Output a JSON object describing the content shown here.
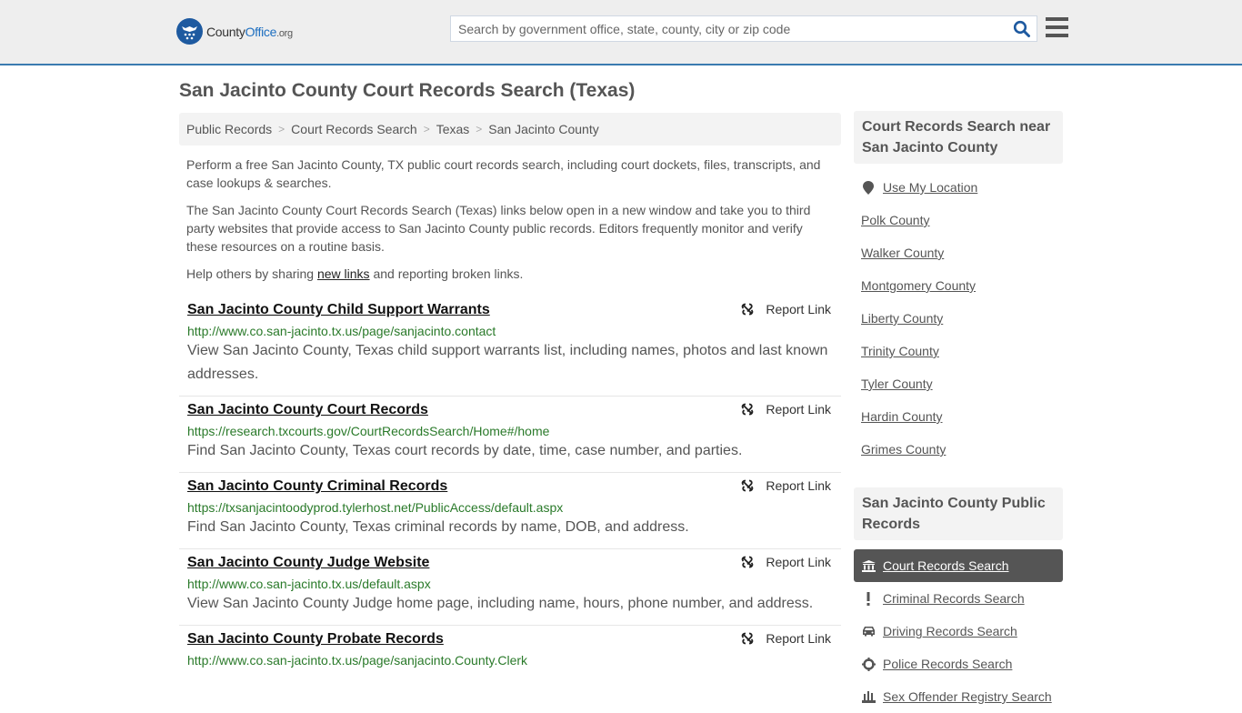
{
  "header": {
    "logo": {
      "prefix": "County",
      "brand": "Office",
      "suffix": ".org"
    },
    "search_placeholder": "Search by government office, state, county, city or zip code",
    "colors": {
      "accent": "#3a7bb0",
      "logo_blue": "#1e5aa0"
    }
  },
  "page": {
    "title": "San Jacinto County Court Records Search (Texas)"
  },
  "breadcrumb": [
    {
      "label": "Public Records"
    },
    {
      "label": "Court Records Search"
    },
    {
      "label": "Texas"
    },
    {
      "label": "San Jacinto County"
    }
  ],
  "breadcrumb_separator": ">",
  "intro": {
    "p1": "Perform a free San Jacinto County, TX public court records search, including court dockets, files, transcripts, and case lookups & searches.",
    "p2": "The San Jacinto County Court Records Search (Texas) links below open in a new window and take you to third party websites that provide access to San Jacinto County public records. Editors frequently monitor and verify these resources on a routine basis.",
    "p3_before": "Help others by sharing ",
    "p3_link": "new links",
    "p3_after": " and reporting broken links."
  },
  "results": [
    {
      "title": "San Jacinto County Child Support Warrants",
      "url": "http://www.co.san-jacinto.tx.us/page/sanjacinto.contact",
      "description": "View San Jacinto County, Texas child support warrants list, including names, photos and last known addresses.",
      "report_label": "Report Link"
    },
    {
      "title": "San Jacinto County Court Records",
      "url": "https://research.txcourts.gov/CourtRecordsSearch/Home#/home",
      "description": "Find San Jacinto County, Texas court records by date, time, case number, and parties.",
      "report_label": "Report Link"
    },
    {
      "title": "San Jacinto County Criminal Records",
      "url": "https://txsanjacintoodyprod.tylerhost.net/PublicAccess/default.aspx",
      "description": "Find San Jacinto County, Texas criminal records by name, DOB, and address.",
      "report_label": "Report Link"
    },
    {
      "title": "San Jacinto County Judge Website",
      "url": "http://www.co.san-jacinto.tx.us/default.aspx",
      "description": "View San Jacinto County Judge home page, including name, hours, phone number, and address.",
      "report_label": "Report Link"
    },
    {
      "title": "San Jacinto County Probate Records",
      "url": "http://www.co.san-jacinto.tx.us/page/sanjacinto.County.Clerk",
      "description": "",
      "report_label": "Report Link"
    }
  ],
  "sidebar": {
    "nearby": {
      "heading": "Court Records Search near San Jacinto County",
      "use_location": {
        "label": "Use My Location",
        "icon": "map-marker-icon"
      },
      "counties": [
        "Polk County",
        "Walker County",
        "Montgomery County",
        "Liberty County",
        "Trinity County",
        "Tyler County",
        "Hardin County",
        "Grimes County"
      ]
    },
    "public_records": {
      "heading": "San Jacinto County Public Records",
      "items": [
        {
          "label": "Court Records Search",
          "icon": "courthouse-icon",
          "active": true
        },
        {
          "label": "Criminal Records Search",
          "icon": "exclamation-icon",
          "active": false
        },
        {
          "label": "Driving Records Search",
          "icon": "car-icon",
          "active": false
        },
        {
          "label": "Police Records Search",
          "icon": "crosshair-icon",
          "active": false
        },
        {
          "label": "Sex Offender Registry Search",
          "icon": "people-icon",
          "active": false
        }
      ]
    }
  }
}
